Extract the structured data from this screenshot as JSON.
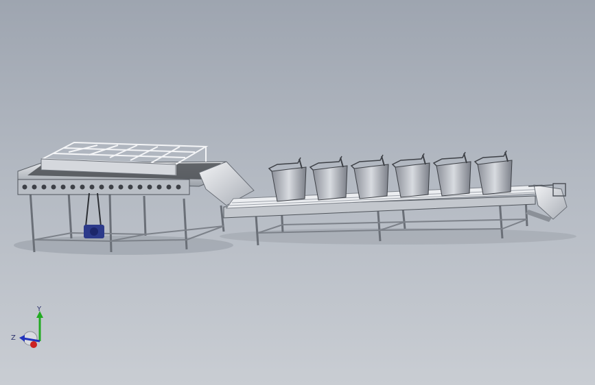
{
  "viewport": {
    "background_top": "#9ea5b0",
    "background_bottom": "#c9cdd3"
  },
  "triad": {
    "y_label": "Y",
    "z_label": "Z",
    "x_color": "#cc2222",
    "y_color": "#22aa22",
    "z_color": "#2233bb"
  },
  "model": {
    "rack_count": 6,
    "steel_color": "#c8ccd2",
    "dark_belt_color": "#4a4d52",
    "motor_color": "#2c3a8a"
  }
}
